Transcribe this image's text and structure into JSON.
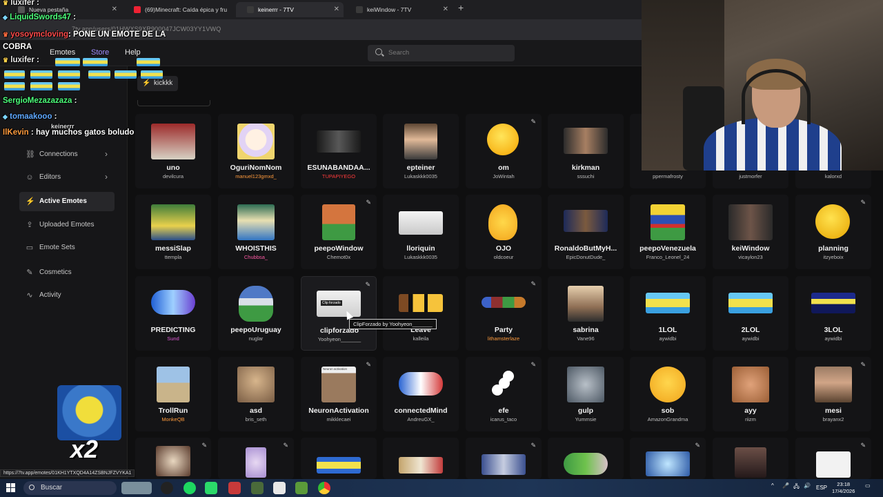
{
  "browser": {
    "tabs": [
      {
        "label": "Nueva pestaña",
        "active": false
      },
      {
        "label": "(69)Minecraft: Caída épica y fru",
        "active": false
      },
      {
        "label": "keinerrr - 7TV",
        "active": true
      },
      {
        "label": "keiWindow - 7TV",
        "active": false
      }
    ],
    "url": "7tv.app/users/01HWXS9XR900047JCW03YY1VWQ",
    "status_url": "https://7tv.app/emotes/01KH1YTXQD4A14ZSBNJFZVYKA1"
  },
  "site": {
    "nav": [
      {
        "label": "Emotes"
      },
      {
        "label": "Store"
      },
      {
        "label": "Help"
      }
    ],
    "search_placeholder": "Search",
    "user_chip": "kickkk"
  },
  "sidebar": {
    "items": [
      {
        "label": "Connections",
        "icon": "link-icon",
        "chevron": true
      },
      {
        "label": "Editors",
        "icon": "user-icon",
        "chevron": true
      },
      {
        "label": "Active Emotes",
        "icon": "bolt-icon",
        "active": true
      },
      {
        "label": "Uploaded Emotes",
        "icon": "upload-icon"
      },
      {
        "label": "Emote Sets",
        "icon": "folder-icon"
      },
      {
        "label": "Cosmetics",
        "icon": "brush-icon"
      },
      {
        "label": "Activity",
        "icon": "activity-icon"
      }
    ]
  },
  "emotes": {
    "row1": [
      {
        "name": "uno",
        "author": "devilcura"
      },
      {
        "name": "OguriNomNom",
        "author": "manuel123gmxd_"
      },
      {
        "name": "ESUNABANDAA...",
        "author": "TUPAPIYEGO"
      },
      {
        "name": "epteiner",
        "author": "Lukaskkk0035"
      },
      {
        "name": "om",
        "author": "JoWintah"
      },
      {
        "name": "kirkman",
        "author": "sssuchi"
      },
      {
        "name": "",
        "author": "ppermafrosty"
      },
      {
        "name": "",
        "author": "justmorfer"
      },
      {
        "name": "",
        "author": "kalorxd"
      }
    ],
    "row2": [
      {
        "name": "messiSlap",
        "author": "ttempla"
      },
      {
        "name": "WHOISTHIS",
        "author": "Chubbsa_"
      },
      {
        "name": "peepoWindow",
        "author": "Chemot0x"
      },
      {
        "name": "lloriquin",
        "author": "Lukaskkk0035"
      },
      {
        "name": "OJO",
        "author": "oldcoeur"
      },
      {
        "name": "RonaldoButMyH...",
        "author": "EpicDonutDude_"
      },
      {
        "name": "peepoVenezuela",
        "author": "Franco_Leonel_24"
      },
      {
        "name": "keiWindow",
        "author": "vicaylon23"
      },
      {
        "name": "planning",
        "author": "itzyeboix"
      }
    ],
    "row3": [
      {
        "name": "PREDICTING",
        "author": "Sund"
      },
      {
        "name": "peepoUruguay",
        "author": "nuglar"
      },
      {
        "name": "clipforzado",
        "author": "Yoohyeon_______"
      },
      {
        "name": "Leave",
        "author": "kalleila"
      },
      {
        "name": "Party",
        "author": "lithamsterlaze"
      },
      {
        "name": "sabrina",
        "author": "Vane96"
      },
      {
        "name": "1LOL",
        "author": "aywidbi"
      },
      {
        "name": "2LOL",
        "author": "aywidbi"
      },
      {
        "name": "3LOL",
        "author": "aywidbi"
      }
    ],
    "row4": [
      {
        "name": "TrollRun",
        "author": "MonkeQB"
      },
      {
        "name": "asd",
        "author": "bris_seth"
      },
      {
        "name": "NeuronActivation",
        "author": "mikklecaei"
      },
      {
        "name": "connectedMind",
        "author": "AndreuGX_"
      },
      {
        "name": "efe",
        "author": "icarus_taco"
      },
      {
        "name": "gulp",
        "author": "Yummsie"
      },
      {
        "name": "sob",
        "author": "AmazonGrandma"
      },
      {
        "name": "ayy",
        "author": "riizm"
      },
      {
        "name": "mesi",
        "author": "brayanx2"
      }
    ],
    "tooltip": "ClipForzado by Yoohyeon_______",
    "neuron_caption": "Neuron activation",
    "clip_caption": "Clip forzado"
  },
  "chat": [
    {
      "user": "luxifer",
      "msg": ":"
    },
    {
      "user": "LiquidSwords47",
      "msg": ":"
    },
    {
      "user": "yosoymcloving",
      "msg": ": PONE UN EMOTE DE LA COBRA"
    },
    {
      "user": "luxifer",
      "msg": ":"
    },
    {
      "user": "SergioMezazazaza",
      "msg": ":"
    },
    {
      "user": "tomaakooo",
      "msg": ":"
    },
    {
      "user": "IlKevin",
      "msg": ": hay muchos gatos boludo"
    }
  ],
  "chat_extra": "keinerrr",
  "overlay_multiplier": "x2",
  "taskbar": {
    "search_label": "Buscar",
    "language": "ESP",
    "time": "23:18",
    "date": "17/4/2026"
  }
}
